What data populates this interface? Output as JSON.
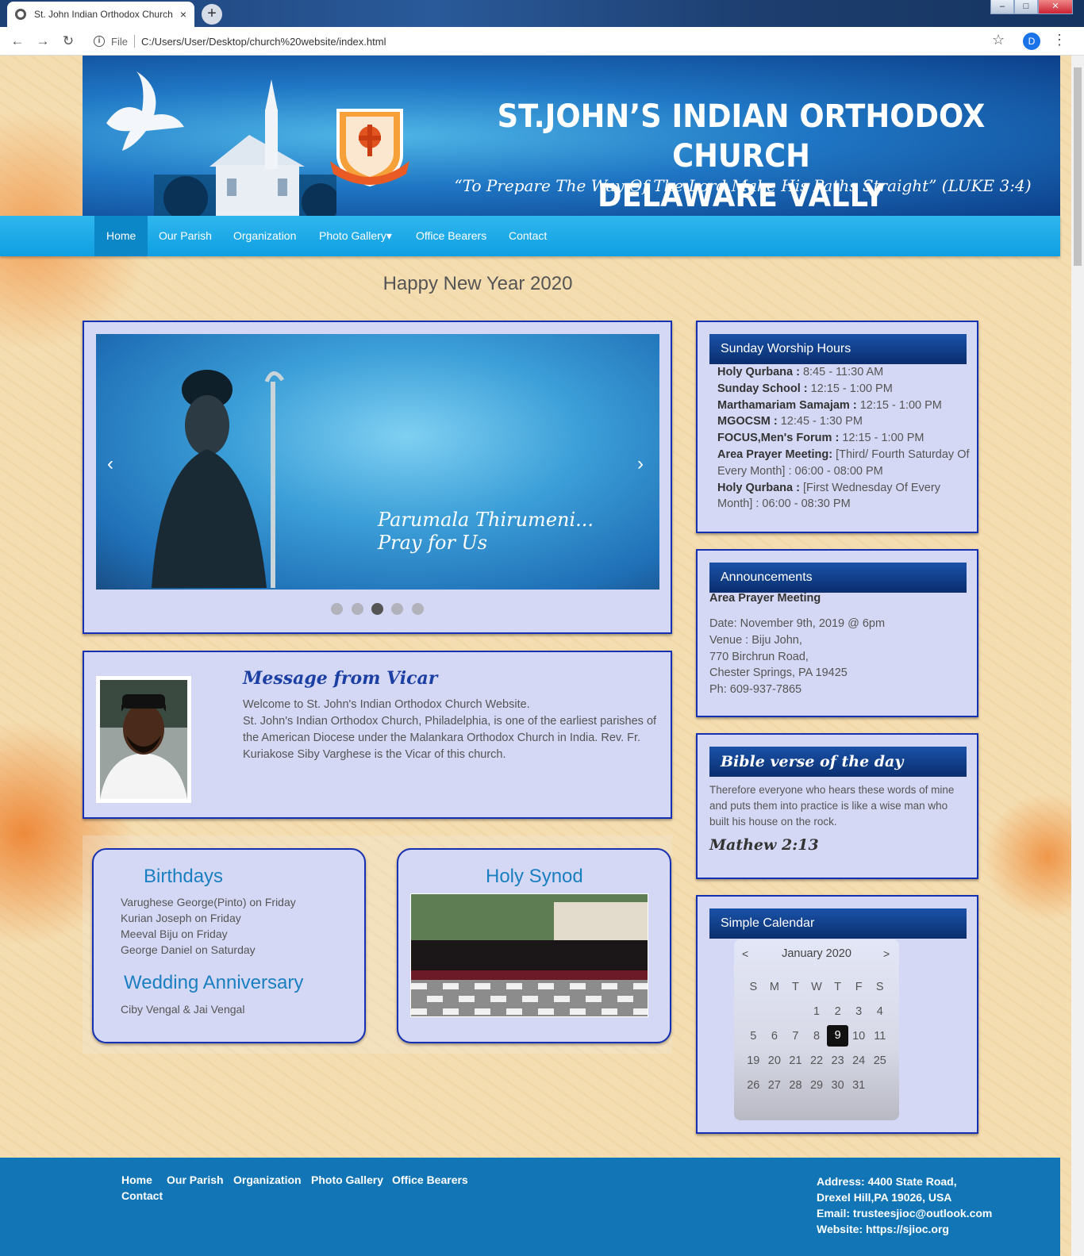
{
  "browser": {
    "tab_title": "St. John Indian Orthodox Church",
    "tab_close": "×",
    "new_tab": "+",
    "back_icon": "←",
    "forward_icon": "→",
    "reload_icon": "↻",
    "scheme_label": "File",
    "url": "C:/Users/User/Desktop/church%20website/index.html",
    "star_icon": "☆",
    "profile_initial": "D",
    "menu_icon": "⋮",
    "window_min": "–",
    "window_max": "□",
    "window_close": "✕"
  },
  "banner": {
    "title_line1": "ST.JOHN’S INDIAN ORTHODOX CHURCH",
    "title_line2": "DELAWARE VALLY",
    "subtitle": "“To Prepare The Way Of The Lord,Make His Paths Straight” (LUKE 3:4)"
  },
  "nav": {
    "items": [
      "Home",
      "Our Parish",
      "Organization",
      "Photo Gallery",
      "Office Bearers",
      "Contact"
    ],
    "dropdown_caret": "▾"
  },
  "headline": "Happy New Year 2020",
  "carousel": {
    "caption_line1": "Parumala Thirumeni...",
    "caption_line2": "Pray for Us",
    "prev": "‹",
    "next": "›",
    "slide_count": 5,
    "active_index": 2
  },
  "vicar": {
    "title": "Message from Vicar",
    "line1": "Welcome to St. John's Indian Orthodox Church Website.",
    "line2": "St. John's Indian Orthodox Church, Philadelphia, is one of the earliest parishes of the American Diocese under the Malankara Orthodox Church in India. Rev. Fr. Kuriakose Siby Varghese is the Vicar of this church."
  },
  "birthdays": {
    "title": "Birthdays",
    "items": [
      "Varughese George(Pinto) on Friday",
      "Kurian Joseph on Friday",
      "Meeval Biju on Friday",
      "George Daniel on Saturday"
    ],
    "anniversary_title": "Wedding Anniversary",
    "anniversary_items": [
      "Ciby Vengal & Jai Vengal"
    ]
  },
  "synod": {
    "title": "Holy Synod"
  },
  "worship": {
    "title": "Sunday Worship Hours",
    "items": [
      {
        "label": "Holy Qurbana :",
        "value": " 8:45 - 11:30 AM"
      },
      {
        "label": "Sunday School :",
        "value": " 12:15 - 1:00 PM"
      },
      {
        "label": "Marthamariam Samajam :",
        "value": " 12:15 - 1:00 PM"
      },
      {
        "label": "MGOCSM :",
        "value": " 12:45 - 1:30 PM"
      },
      {
        "label": "FOCUS,Men's Forum :",
        "value": " 12:15 - 1:00 PM"
      },
      {
        "label": "Area Prayer Meeting:",
        "value": " [Third/ Fourth Saturday Of Every Month] : 06:00 - 08:00 PM"
      },
      {
        "label": "Holy Qurbana :",
        "value": " [First Wednesday Of Every Month] : 06:00 - 08:30 PM"
      }
    ]
  },
  "announcements": {
    "title": "Announcements",
    "subtitle": "Area Prayer Meeting",
    "lines": [
      "Date: November 9th, 2019 @ 6pm",
      "Venue : Biju John,",
      "770 Birchrun Road,",
      "Chester Springs, PA 19425",
      "Ph: 609-937-7865"
    ]
  },
  "bible": {
    "title": "Bible verse of the day",
    "text": "Therefore everyone who hears these words of mine and puts them into practice is like a wise man who built his house on the rock.",
    "reference": "Mathew 2:13"
  },
  "calendar": {
    "title": "Simple Calendar",
    "month": "January 2020",
    "prev": "<",
    "next": ">",
    "weekdays": [
      "S",
      "M",
      "T",
      "W",
      "T",
      "F",
      "S"
    ],
    "weeks": [
      [
        "",
        "",
        "",
        "1",
        "2",
        "3",
        "4"
      ],
      [
        "5",
        "6",
        "7",
        "8",
        "9",
        "10",
        "11"
      ],
      [
        "19",
        "20",
        "21",
        "22",
        "23",
        "24",
        "25"
      ],
      [
        "26",
        "27",
        "28",
        "29",
        "30",
        "31",
        ""
      ]
    ],
    "today": "9"
  },
  "footer": {
    "links": [
      "Home",
      "Our Parish",
      "Organization",
      "Photo Gallery",
      "Office Bearers",
      "Contact"
    ],
    "address_lines": [
      "Address: 4400 State Road,",
      "Drexel Hill,PA 19026, USA",
      "Email: trusteesjioc@outlook.com",
      "Website: https://sjioc.org"
    ]
  },
  "colors": {
    "nav_blue": "#0f9fe2",
    "panel_border": "#1530b0",
    "panel_bg": "#d5d8f4",
    "footer_blue": "#1276b6"
  }
}
